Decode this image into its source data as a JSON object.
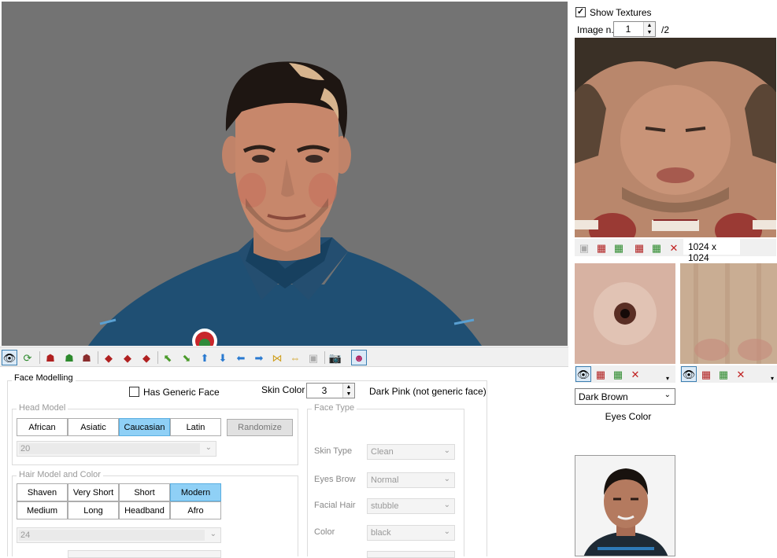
{
  "texture_panel": {
    "show_textures_label": "Show Textures",
    "show_textures_checked": true,
    "image_n_label": "Image n.",
    "image_n_value": "1",
    "image_total": "/2",
    "texture_size": "1024 x 1024",
    "eyes_color_value": "Dark Brown",
    "eyes_color_label": "Eyes Color"
  },
  "face_modelling": {
    "title": "Face Modelling",
    "has_generic_face_label": "Has Generic Face",
    "has_generic_face_checked": false,
    "skin_color_label": "Skin Color",
    "skin_color_value": "3",
    "skin_color_description": "Dark Pink (not generic face)",
    "head_model": {
      "title": "Head Model",
      "buttons": [
        "African",
        "Asiatic",
        "Caucasian",
        "Latin"
      ],
      "selected": "Caucasian",
      "randomize_label": "Randomize",
      "model_value": "20"
    },
    "hair_model": {
      "title": "Hair Model and Color",
      "row1": [
        "Shaven",
        "Very Short",
        "Short",
        "Modern"
      ],
      "row2": [
        "Medium",
        "Long",
        "Headband",
        "Afro"
      ],
      "selected": "Modern",
      "model_value": "24"
    },
    "face_type": {
      "title": "Face Type",
      "fields": [
        {
          "label": "Skin Type",
          "value": "Clean"
        },
        {
          "label": "Eyes Brow",
          "value": "Normal"
        },
        {
          "label": "Facial Hair",
          "value": "stubble"
        },
        {
          "label": "Color",
          "value": "black"
        }
      ]
    }
  },
  "colors": {
    "viewport_bg": "#737373",
    "selected_button": "#8fd0f6",
    "shirt": "#1f4f73"
  }
}
